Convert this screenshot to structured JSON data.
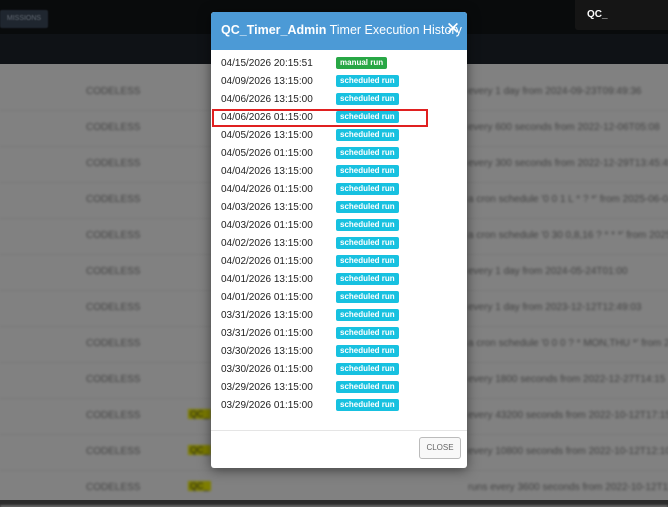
{
  "background": {
    "tab_label": "MISSIONS",
    "rows": [
      {
        "type": "CODELESS",
        "schedule": "every 1 day from 2024-09-23T09:49:36",
        "tag": ""
      },
      {
        "type": "CODELESS",
        "schedule": "every 600 seconds from 2022-12-06T05:08",
        "tag": ""
      },
      {
        "type": "CODELESS",
        "schedule": "every 300 seconds from 2022-12-29T13:45:45",
        "tag": ""
      },
      {
        "type": "CODELESS",
        "schedule": "a cron schedule '0 0 1 L * ? *' from 2025-06-04",
        "tag": ""
      },
      {
        "type": "CODELESS",
        "schedule": "a cron schedule '0 30 0,8,16 ? * * *' from 2025-0",
        "tag": ""
      },
      {
        "type": "CODELESS",
        "schedule": "every 1 day from 2024-05-24T01:00",
        "tag": ""
      },
      {
        "type": "CODELESS",
        "schedule": "every 1 day from 2023-12-12T12:49:03",
        "tag": ""
      },
      {
        "type": "CODELESS",
        "schedule": "a cron schedule '0 0 0 ? * MON,THU *' from 202",
        "tag": ""
      },
      {
        "type": "CODELESS",
        "schedule": "every 1800 seconds from 2022-12-27T14:15",
        "tag": ""
      },
      {
        "type": "CODELESS",
        "schedule": "every 43200 seconds from 2022-10-12T17:15",
        "tag": "QC_"
      },
      {
        "type": "CODELESS",
        "schedule": "every 10800 seconds from 2022-10-12T12:10:44",
        "tag": "QC_"
      },
      {
        "type": "CODELESS",
        "schedule": "runs every 3600 seconds from 2022-10-12T11:05:14",
        "tag": "QC_"
      }
    ]
  },
  "corner_popup": {
    "text": "QC_"
  },
  "modal": {
    "title_bold": "QC_Timer_Admin",
    "title_rest": "Timer Execution History",
    "close_symbol": "✕",
    "close_button_label": "CLOSE",
    "entries": [
      {
        "date": "04/15/2026 20:15:51",
        "badge": "manual run",
        "kind": "manual"
      },
      {
        "date": "04/09/2026 13:15:00",
        "badge": "scheduled run",
        "kind": "scheduled"
      },
      {
        "date": "04/06/2026 13:15:00",
        "badge": "scheduled run",
        "kind": "scheduled"
      },
      {
        "date": "04/06/2026 01:15:00",
        "badge": "scheduled run",
        "kind": "scheduled"
      },
      {
        "date": "04/05/2026 13:15:00",
        "badge": "scheduled run",
        "kind": "scheduled"
      },
      {
        "date": "04/05/2026 01:15:00",
        "badge": "scheduled run",
        "kind": "scheduled"
      },
      {
        "date": "04/04/2026 13:15:00",
        "badge": "scheduled run",
        "kind": "scheduled"
      },
      {
        "date": "04/04/2026 01:15:00",
        "badge": "scheduled run",
        "kind": "scheduled"
      },
      {
        "date": "04/03/2026 13:15:00",
        "badge": "scheduled run",
        "kind": "scheduled"
      },
      {
        "date": "04/03/2026 01:15:00",
        "badge": "scheduled run",
        "kind": "scheduled"
      },
      {
        "date": "04/02/2026 13:15:00",
        "badge": "scheduled run",
        "kind": "scheduled"
      },
      {
        "date": "04/02/2026 01:15:00",
        "badge": "scheduled run",
        "kind": "scheduled"
      },
      {
        "date": "04/01/2026 13:15:00",
        "badge": "scheduled run",
        "kind": "scheduled"
      },
      {
        "date": "04/01/2026 01:15:00",
        "badge": "scheduled run",
        "kind": "scheduled"
      },
      {
        "date": "03/31/2026 13:15:00",
        "badge": "scheduled run",
        "kind": "scheduled"
      },
      {
        "date": "03/31/2026 01:15:00",
        "badge": "scheduled run",
        "kind": "scheduled"
      },
      {
        "date": "03/30/2026 13:15:00",
        "badge": "scheduled run",
        "kind": "scheduled"
      },
      {
        "date": "03/30/2026 01:15:00",
        "badge": "scheduled run",
        "kind": "scheduled"
      },
      {
        "date": "03/29/2026 13:15:00",
        "badge": "scheduled run",
        "kind": "scheduled"
      },
      {
        "date": "03/29/2026 01:15:00",
        "badge": "scheduled run",
        "kind": "scheduled"
      }
    ]
  },
  "colors": {
    "header": "#4c9ad6",
    "manual_badge": "#28a745",
    "scheduled_badge": "#17c1e0",
    "highlight": "#e02020"
  }
}
